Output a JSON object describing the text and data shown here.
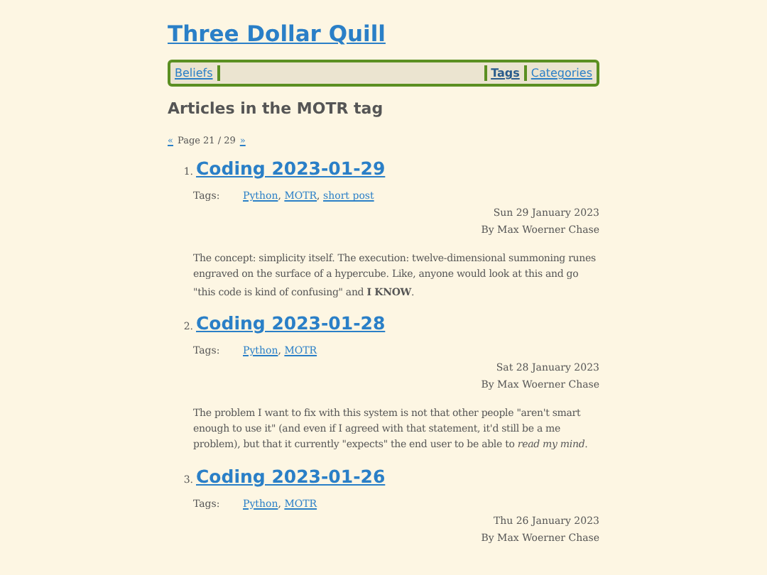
{
  "site_title": "Three Dollar Quill",
  "nav": {
    "left": [
      {
        "label": "Beliefs",
        "selected": false
      }
    ],
    "right": [
      {
        "label": "Tags",
        "selected": true
      },
      {
        "label": "Categories",
        "selected": false
      }
    ]
  },
  "heading": "Articles in the MOTR tag",
  "pagination": {
    "prev": "«",
    "text": "Page 21 / 29",
    "next": "»"
  },
  "articles": [
    {
      "number": "1.",
      "title": "Coding 2023-01-29",
      "tags_label": "Tags:",
      "tags": [
        "Python",
        "MOTR",
        "short post"
      ],
      "tag_separator": ",",
      "date": "Sun 29 January 2023",
      "author": "By Max Woerner Chase",
      "excerpt": "The concept: simplicity itself. The execution: twelve-dimensional summoning runes engraved on the surface of a hypercube. Like, anyone would look at this and go \"this code is kind of confusing\" and **I KNOW**."
    },
    {
      "number": "2.",
      "title": "Coding 2023-01-28",
      "tags_label": "Tags:",
      "tags": [
        "Python",
        "MOTR"
      ],
      "tag_separator": ",",
      "date": "Sat 28 January 2023",
      "author": "By Max Woerner Chase",
      "excerpt": "The problem I want to fix with this system is not that other people \"aren't smart enough to use it\" (and even if I agreed with that statement, it'd still be a me problem), but that it currently \"expects\" the end user to be able to *read my mind*."
    },
    {
      "number": "3.",
      "title": "Coding 2023-01-26",
      "tags_label": "Tags:",
      "tags": [
        "Python",
        "MOTR"
      ],
      "tag_separator": ",",
      "date": "Thu 26 January 2023",
      "author": "By Max Woerner Chase"
    }
  ]
}
